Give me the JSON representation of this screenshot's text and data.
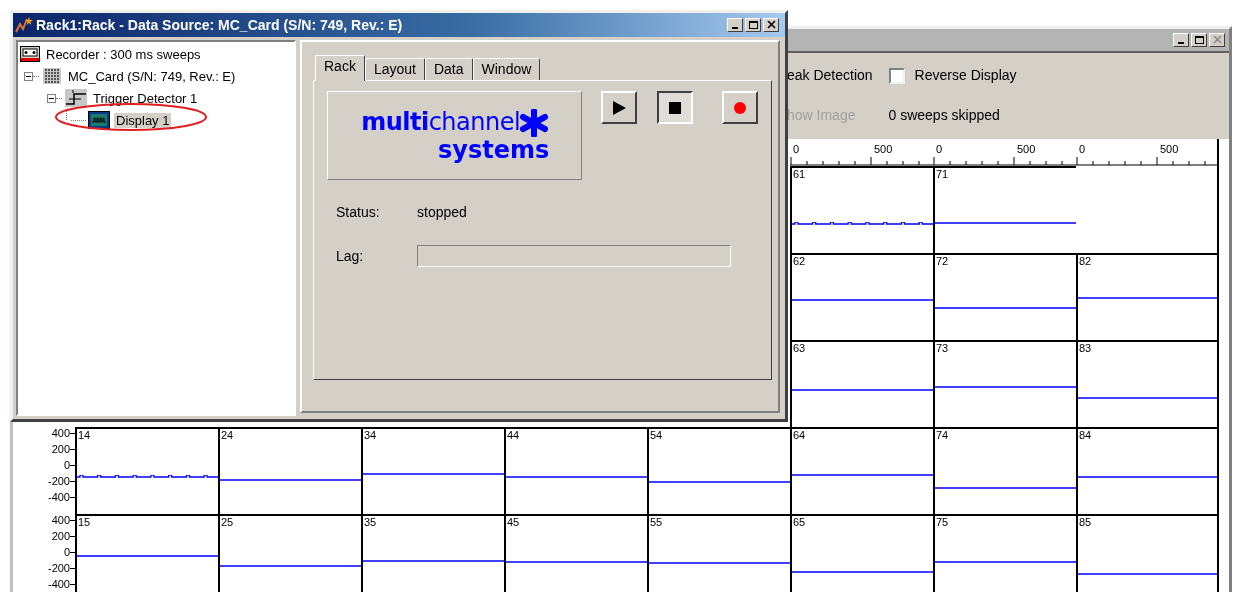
{
  "rack_window": {
    "title": "Rack1:Rack - Data Source: MC_Card (S/N: 749, Rev.: E)",
    "tree": [
      {
        "label": "Recorder : 300 ms sweeps",
        "kind": "recorder",
        "selected": false
      },
      {
        "label": "MC_Card (S/N: 749, Rev.: E)",
        "kind": "card",
        "selected": false,
        "expanded": true,
        "children": [
          {
            "label": "Trigger Detector 1",
            "kind": "trigger",
            "selected": false,
            "expanded": true,
            "children": [
              {
                "label": "Display 1",
                "kind": "display",
                "selected": true,
                "circled": true
              }
            ]
          }
        ]
      }
    ],
    "tabs": [
      {
        "label": "Rack",
        "selected": true
      },
      {
        "label": "Layout",
        "selected": false
      },
      {
        "label": "Data",
        "selected": false
      },
      {
        "label": "Window",
        "selected": false
      }
    ],
    "logo": {
      "line_1": "**multi**channel",
      "line_2": "systems"
    },
    "transport": [
      {
        "kind": "play",
        "pressed": false
      },
      {
        "kind": "stop",
        "pressed": true
      },
      {
        "kind": "record",
        "pressed": false
      }
    ],
    "status": {
      "label": "Status:",
      "value": "stopped"
    },
    "lag": {
      "label": "Lag:"
    }
  },
  "display_window": {
    "options_row_1": [
      {
        "kind": "text",
        "label": "eak Detection",
        "disabled": false
      },
      {
        "kind": "checkbox",
        "label": "Reverse Display",
        "checked": false
      }
    ],
    "options_row_2": [
      {
        "kind": "text",
        "label": "how Image",
        "disabled": true
      },
      {
        "kind": "text",
        "label": "0 sweeps skipped",
        "disabled": false
      }
    ],
    "y_axes": [
      {
        "labels": [
          "400",
          "200",
          "0",
          "-200",
          "-400"
        ]
      },
      {
        "labels": [
          "400",
          "200",
          "0",
          "-200",
          "-400"
        ]
      }
    ],
    "columns": [
      {
        "cells": [
          {
            "label": "14"
          },
          {
            "label": "15"
          }
        ]
      },
      {
        "cells": [
          {
            "label": "24"
          },
          {
            "label": "25"
          }
        ]
      },
      {
        "cells": [
          {
            "label": "34"
          },
          {
            "label": "35"
          }
        ]
      },
      {
        "cells": [
          {
            "label": "44"
          },
          {
            "label": "45"
          }
        ]
      },
      {
        "cells": [
          {
            "label": "54"
          },
          {
            "label": "55"
          }
        ]
      },
      {
        "ticks": [
          "0",
          "500"
        ],
        "cells": [
          {
            "label": "61"
          },
          {
            "label": "62"
          },
          {
            "label": "63"
          },
          {
            "label": "64"
          },
          {
            "label": "65"
          }
        ]
      },
      {
        "ticks": [
          "0",
          "500"
        ],
        "cells": [
          {
            "label": "71"
          },
          {
            "label": "72"
          },
          {
            "label": "73"
          },
          {
            "label": "74"
          },
          {
            "label": "75"
          }
        ]
      },
      {
        "ticks": [
          "0",
          "500"
        ],
        "cells": [
          {
            "label": "82"
          },
          {
            "label": "83"
          },
          {
            "label": "84"
          },
          {
            "label": "85"
          }
        ]
      }
    ]
  }
}
